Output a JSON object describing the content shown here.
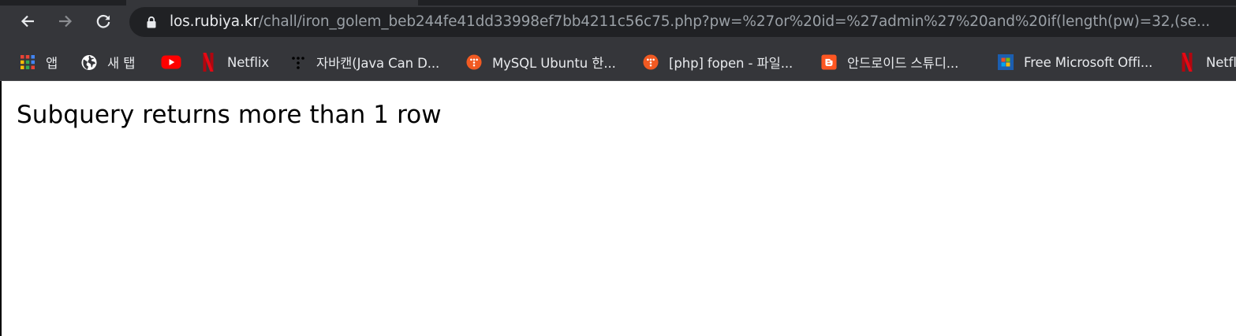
{
  "browser": {
    "nav": {
      "back_icon": "arrow-left-icon",
      "forward_icon": "arrow-right-icon",
      "reload_icon": "reload-icon"
    },
    "address_bar": {
      "lock_icon": "lock-icon",
      "host": "los.rubiya.kr",
      "path": "/chall/iron_golem_beb244fe41dd33998ef7bb4211c56c75.php?pw=%27or%20id=%27admin%27%20and%20if(length(pw)=32,(se..."
    },
    "bookmarks": [
      {
        "label": "앱",
        "icon": "apps-grid-icon",
        "color": "#ea4335"
      },
      {
        "label": "새 탭",
        "icon": "globe-icon",
        "color": "#ffffff"
      },
      {
        "label": "",
        "icon": "youtube-icon",
        "color": "#ff0000"
      },
      {
        "label": "Netflix",
        "icon": "netflix-icon",
        "color": "#e50914"
      },
      {
        "label": "자바캔(Java Can D...",
        "icon": "tistory-dots-icon",
        "color": "#000000"
      },
      {
        "label": "MySQL Ubuntu 한...",
        "icon": "tistory-icon",
        "color": "#f15a22"
      },
      {
        "label": "[php] fopen - 파일...",
        "icon": "tistory-icon",
        "color": "#f15a22"
      },
      {
        "label": "안드로이드 스튜디...",
        "icon": "blogger-icon",
        "color": "#ff5722"
      },
      {
        "label": "Free Microsoft Offi...",
        "icon": "microsoft-icon",
        "color": "#1b5eb0"
      },
      {
        "label": "Netfl",
        "icon": "netflix-icon",
        "color": "#e50914"
      }
    ]
  },
  "page": {
    "message": "Subquery returns more than 1 row"
  }
}
